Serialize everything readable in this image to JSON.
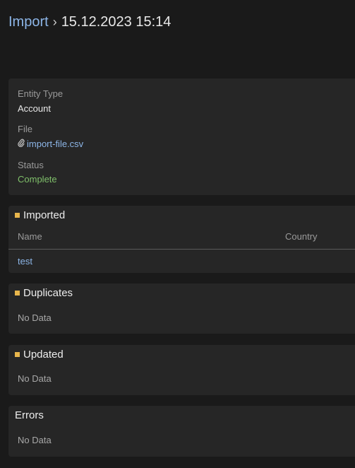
{
  "breadcrumb": {
    "parent": "Import",
    "separator": "›",
    "current": "15.12.2023 15:14"
  },
  "details": {
    "entity_type_label": "Entity Type",
    "entity_type_value": "Account",
    "file_label": "File",
    "file_icon": "paperclip-icon",
    "file_value": "import-file.csv",
    "status_label": "Status",
    "status_value": "Complete"
  },
  "imported": {
    "title": "Imported",
    "columns": [
      "Name",
      "Country"
    ],
    "rows": [
      {
        "name": "test",
        "country": ""
      }
    ]
  },
  "duplicates": {
    "title": "Duplicates",
    "empty": "No Data"
  },
  "updated": {
    "title": "Updated",
    "empty": "No Data"
  },
  "errors": {
    "title": "Errors",
    "empty": "No Data"
  },
  "colors": {
    "link": "#8db6e8",
    "status_complete": "#7fbf6a",
    "marker": "#e8b64c"
  }
}
